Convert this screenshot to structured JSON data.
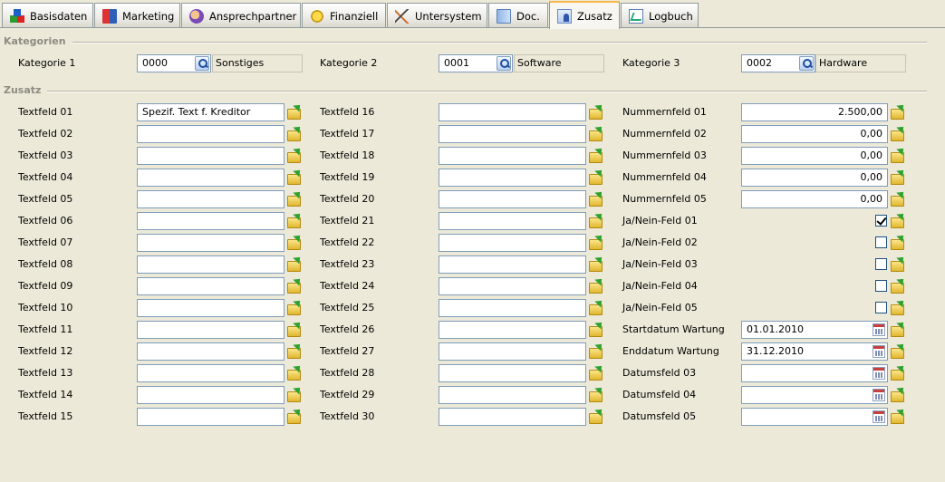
{
  "tabs": [
    {
      "label": "Basisdaten",
      "icon": "cubes-icon"
    },
    {
      "label": "Marketing",
      "icon": "book-icon"
    },
    {
      "label": "Ansprechpartner",
      "icon": "contacts-icon"
    },
    {
      "label": "Finanziell",
      "icon": "coins-icon"
    },
    {
      "label": "Untersystem",
      "icon": "tree-icon"
    },
    {
      "label": "Doc.",
      "icon": "document-icon"
    },
    {
      "label": "Zusatz",
      "icon": "user-form-icon"
    },
    {
      "label": "Logbuch",
      "icon": "chart-icon"
    }
  ],
  "active_tab": "Zusatz",
  "groups": {
    "kategorien": "Kategorien",
    "zusatz": "Zusatz"
  },
  "kategorien": [
    {
      "label": "Kategorie 1",
      "code": "0000",
      "name": "Sonstiges"
    },
    {
      "label": "Kategorie 2",
      "code": "0001",
      "name": "Software"
    },
    {
      "label": "Kategorie 3",
      "code": "0002",
      "name": "Hardware"
    }
  ],
  "textfields_col1": [
    {
      "label": "Textfeld 01",
      "value": "Spezif. Text f. Kreditor"
    },
    {
      "label": "Textfeld 02",
      "value": ""
    },
    {
      "label": "Textfeld 03",
      "value": ""
    },
    {
      "label": "Textfeld 04",
      "value": ""
    },
    {
      "label": "Textfeld 05",
      "value": ""
    },
    {
      "label": "Textfeld 06",
      "value": ""
    },
    {
      "label": "Textfeld 07",
      "value": ""
    },
    {
      "label": "Textfeld 08",
      "value": ""
    },
    {
      "label": "Textfeld 09",
      "value": ""
    },
    {
      "label": "Textfeld 10",
      "value": ""
    },
    {
      "label": "Textfeld 11",
      "value": ""
    },
    {
      "label": "Textfeld 12",
      "value": ""
    },
    {
      "label": "Textfeld 13",
      "value": ""
    },
    {
      "label": "Textfeld 14",
      "value": ""
    },
    {
      "label": "Textfeld 15",
      "value": ""
    }
  ],
  "textfields_col2": [
    {
      "label": "Textfeld 16",
      "value": ""
    },
    {
      "label": "Textfeld 17",
      "value": ""
    },
    {
      "label": "Textfeld 18",
      "value": ""
    },
    {
      "label": "Textfeld 19",
      "value": ""
    },
    {
      "label": "Textfeld 20",
      "value": ""
    },
    {
      "label": "Textfeld 21",
      "value": ""
    },
    {
      "label": "Textfeld 22",
      "value": ""
    },
    {
      "label": "Textfeld 23",
      "value": ""
    },
    {
      "label": "Textfeld 24",
      "value": ""
    },
    {
      "label": "Textfeld 25",
      "value": ""
    },
    {
      "label": "Textfeld 26",
      "value": ""
    },
    {
      "label": "Textfeld 27",
      "value": ""
    },
    {
      "label": "Textfeld 28",
      "value": ""
    },
    {
      "label": "Textfeld 29",
      "value": ""
    },
    {
      "label": "Textfeld 30",
      "value": ""
    }
  ],
  "col3": [
    {
      "type": "number",
      "label": "Nummernfeld 01",
      "value": "2.500,00"
    },
    {
      "type": "number",
      "label": "Nummernfeld 02",
      "value": "0,00"
    },
    {
      "type": "number",
      "label": "Nummernfeld 03",
      "value": "0,00"
    },
    {
      "type": "number",
      "label": "Nummernfeld 04",
      "value": "0,00"
    },
    {
      "type": "number",
      "label": "Nummernfeld 05",
      "value": "0,00"
    },
    {
      "type": "check",
      "label": "Ja/Nein-Feld 01",
      "checked": true
    },
    {
      "type": "check",
      "label": "Ja/Nein-Feld 02",
      "checked": false
    },
    {
      "type": "check",
      "label": "Ja/Nein-Feld 03",
      "checked": false
    },
    {
      "type": "check",
      "label": "Ja/Nein-Feld 04",
      "checked": false
    },
    {
      "type": "check",
      "label": "Ja/Nein-Feld 05",
      "checked": false
    },
    {
      "type": "date",
      "label": "Startdatum Wartung",
      "value": "01.01.2010"
    },
    {
      "type": "date",
      "label": "Enddatum Wartung",
      "value": "31.12.2010"
    },
    {
      "type": "date",
      "label": "Datumsfeld 03",
      "value": ""
    },
    {
      "type": "date",
      "label": "Datumsfeld 04",
      "value": ""
    },
    {
      "type": "date",
      "label": "Datumsfeld 05",
      "value": ""
    }
  ]
}
